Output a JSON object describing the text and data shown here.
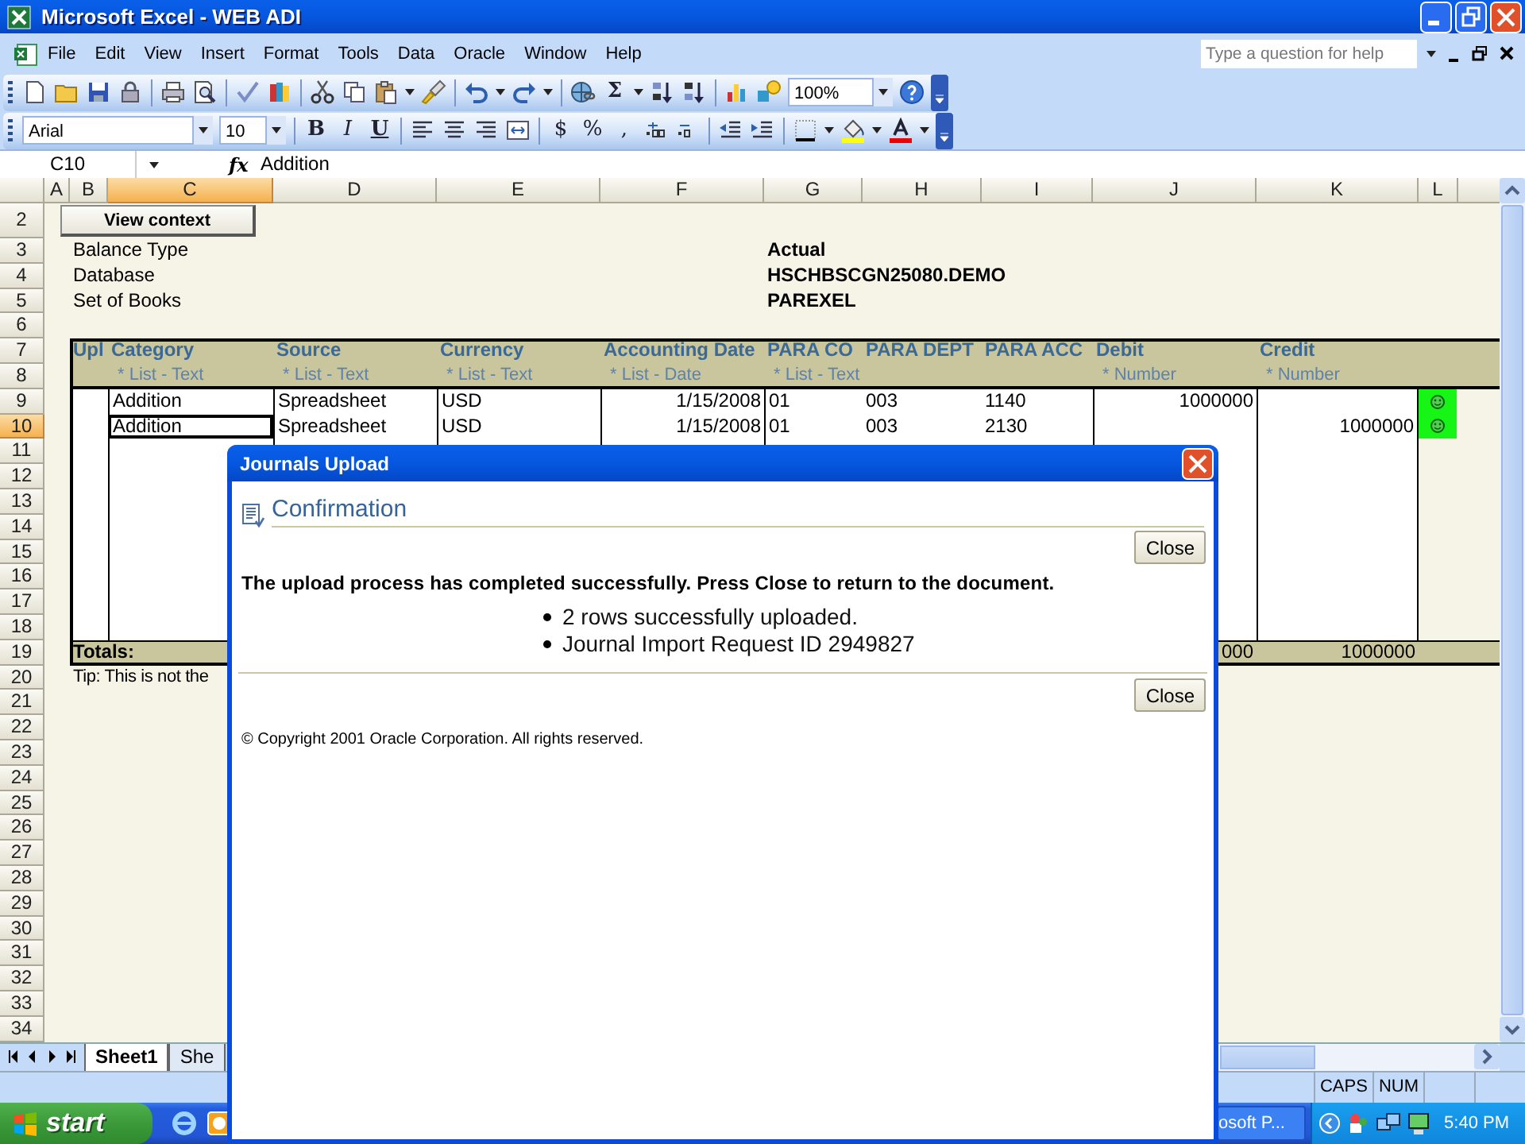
{
  "window": {
    "title": "Microsoft Excel - WEB ADI"
  },
  "menu": [
    "File",
    "Edit",
    "View",
    "Insert",
    "Format",
    "Tools",
    "Data",
    "Oracle",
    "Window",
    "Help"
  ],
  "help_search": {
    "placeholder": "Type a question for help"
  },
  "standard_toolbar": {
    "autosum": "Σ",
    "zoom": "100%"
  },
  "formatting_toolbar": {
    "font": "Arial",
    "font_size": "10",
    "style_buttons": [
      "B",
      "I",
      "U"
    ],
    "number_buttons": [
      "$",
      "%",
      ","
    ]
  },
  "formula_bar": {
    "name_box": "C10",
    "function_label": "fx",
    "value": "Addition"
  },
  "columns": [
    {
      "label": "A",
      "selected": false
    },
    {
      "label": "B",
      "selected": false
    },
    {
      "label": "C",
      "selected": true
    },
    {
      "label": "D",
      "selected": false
    },
    {
      "label": "E",
      "selected": false
    },
    {
      "label": "F",
      "selected": false
    },
    {
      "label": "G",
      "selected": false
    },
    {
      "label": "H",
      "selected": false
    },
    {
      "label": "I",
      "selected": false
    },
    {
      "label": "J",
      "selected": false
    },
    {
      "label": "K",
      "selected": false
    },
    {
      "label": "L",
      "selected": false
    }
  ],
  "row_numbers": [
    {
      "label": "2",
      "selected": false
    },
    {
      "label": "3",
      "selected": false
    },
    {
      "label": "4",
      "selected": false
    },
    {
      "label": "5",
      "selected": false
    },
    {
      "label": "6",
      "selected": false
    },
    {
      "label": "7",
      "selected": false
    },
    {
      "label": "8",
      "selected": false
    },
    {
      "label": "9",
      "selected": false
    },
    {
      "label": "10",
      "selected": true
    },
    {
      "label": "11",
      "selected": false
    },
    {
      "label": "12",
      "selected": false
    },
    {
      "label": "13",
      "selected": false
    },
    {
      "label": "14",
      "selected": false
    },
    {
      "label": "15",
      "selected": false
    },
    {
      "label": "16",
      "selected": false
    },
    {
      "label": "17",
      "selected": false
    },
    {
      "label": "18",
      "selected": false
    },
    {
      "label": "19",
      "selected": false
    },
    {
      "label": "20",
      "selected": false
    },
    {
      "label": "21",
      "selected": false
    },
    {
      "label": "22",
      "selected": false
    },
    {
      "label": "23",
      "selected": false
    },
    {
      "label": "24",
      "selected": false
    },
    {
      "label": "25",
      "selected": false
    },
    {
      "label": "26",
      "selected": false
    },
    {
      "label": "27",
      "selected": false
    },
    {
      "label": "28",
      "selected": false
    },
    {
      "label": "29",
      "selected": false
    },
    {
      "label": "30",
      "selected": false
    },
    {
      "label": "31",
      "selected": false
    },
    {
      "label": "32",
      "selected": false
    },
    {
      "label": "33",
      "selected": false
    },
    {
      "label": "34",
      "selected": false
    }
  ],
  "view_context_button": "View context",
  "header_fields": [
    {
      "label": "Balance Type",
      "value": "Actual"
    },
    {
      "label": "Database",
      "value": "HSCHBSCGN25080.DEMO"
    },
    {
      "label": "Set of Books",
      "value": "PAREXEL"
    }
  ],
  "table": {
    "columns": [
      {
        "title": "Upl"
      },
      {
        "title": "Category",
        "hint": "* List - Text"
      },
      {
        "title": "Source",
        "hint": "* List - Text"
      },
      {
        "title": "Currency",
        "hint": "* List - Text"
      },
      {
        "title": "Accounting Date",
        "hint": "* List - Date"
      },
      {
        "title": "PARA CO",
        "hint": "* List - Text"
      },
      {
        "title": "PARA DEPT"
      },
      {
        "title": "PARA ACC"
      },
      {
        "title": "Debit",
        "hint": "* Number"
      },
      {
        "title": "Credit",
        "hint": "* Number"
      }
    ],
    "rows": [
      {
        "category": "Addition",
        "source": "Spreadsheet",
        "currency": "USD",
        "accounting_date": "1/15/2008",
        "para_co": "01",
        "para_dept": "003",
        "para_acc": "1140",
        "debit": "1000000"
      },
      {
        "category": "Addition",
        "source": "Spreadsheet",
        "currency": "USD",
        "accounting_date": "1/15/2008",
        "para_co": "01",
        "para_dept": "003",
        "para_acc": "2130",
        "credit": "1000000"
      }
    ],
    "totals": {
      "label": "Totals:",
      "debit": "000",
      "credit": "1000000"
    }
  },
  "tip": "Tip: This is not the",
  "sheet_tabs": [
    {
      "label": "Sheet1",
      "selected": true
    },
    {
      "label": "She",
      "selected": false
    }
  ],
  "status_bar": [
    "CAPS",
    "NUM"
  ],
  "taskbar": {
    "start": "start",
    "tasks": [
      "osoft P..."
    ],
    "clock": "5:40 PM"
  },
  "dialog": {
    "title": "Journals Upload",
    "heading": "Confirmation",
    "close_buttons": [
      "Close",
      "Close"
    ],
    "message": "The upload process has completed successfully. Press Close to return to the document.",
    "bullets": [
      "2 rows successfully uploaded.",
      "Journal Import Request ID 2949827"
    ],
    "copyright": "© Copyright 2001 Oracle Corporation. All rights reserved."
  }
}
